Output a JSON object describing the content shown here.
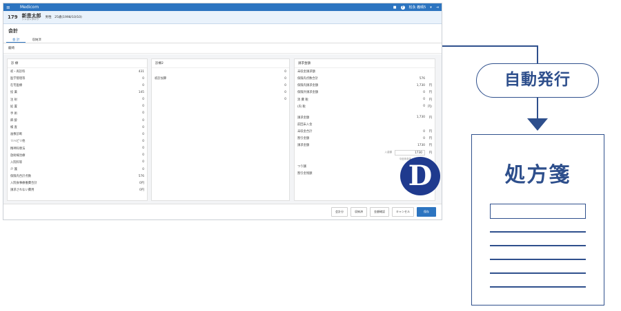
{
  "header": {
    "app_title": "Medicom",
    "user_name": "松永 義晴5",
    "help_icon_label": "?"
  },
  "patient": {
    "id": "179",
    "name": "新患太郎",
    "kana": "シンカンタロウ",
    "info": "男性　25歳(1998/10/10)"
  },
  "page": {
    "title": "会計",
    "subtitle": "龍崎"
  },
  "tabs": [
    {
      "label": "会 計",
      "active": true
    },
    {
      "label": "収納済",
      "active": false
    }
  ],
  "panels": {
    "shinryo": {
      "title": "診 療",
      "rows": [
        {
          "label": "初・再診料",
          "value": "431"
        },
        {
          "label": "医学管理等",
          "value": "0"
        },
        {
          "label": "在宅医療",
          "value": "0"
        },
        {
          "label": "投 薬",
          "value": "145"
        },
        {
          "label": "注 射",
          "value": "0"
        },
        {
          "label": "処 置",
          "value": "0"
        },
        {
          "label": "手 術",
          "value": "0"
        },
        {
          "label": "麻 酔",
          "value": "0"
        },
        {
          "label": "検 査",
          "value": "0"
        },
        {
          "label": "画像診断",
          "value": "0"
        },
        {
          "label": "リハビリ他",
          "value": "0"
        },
        {
          "label": "精神科専法",
          "value": "0"
        },
        {
          "label": "放射線治療",
          "value": "0"
        },
        {
          "label": "入院料等",
          "value": "0"
        },
        {
          "label": "介 護",
          "value": "0"
        },
        {
          "label": "保険内合計点数",
          "value": "576"
        },
        {
          "label": "入院食事療養費合計",
          "value": "0円"
        },
        {
          "label": "請求されない費用",
          "value": "0円"
        }
      ]
    },
    "shinryo2": {
      "title": "診療2",
      "rows": [
        {
          "label": "",
          "value": "0"
        },
        {
          "label": "初診加算",
          "value": "0"
        },
        {
          "label": "",
          "value": "0"
        },
        {
          "label": "",
          "value": "0"
        },
        {
          "label": "",
          "value": "0"
        }
      ]
    },
    "seikyu": {
      "title": "請求金額",
      "rows": [
        {
          "label": "未収金請求額",
          "value": "",
          "unit": ""
        },
        {
          "label": "保険内点数合計",
          "value": "576",
          "unit": ""
        },
        {
          "label": "保険内請求金額",
          "value": "1,730",
          "unit": "円"
        },
        {
          "label": "保険外請求金額",
          "value": "0",
          "unit": "円"
        },
        {
          "label": "消 費 税",
          "value": "0",
          "unit": "円"
        },
        {
          "label": "(内 税",
          "value": "0",
          "unit": "円)"
        },
        {
          "label": "",
          "value": "",
          "unit": ""
        },
        {
          "label": "請求金額",
          "value": "1,730",
          "unit": "円"
        },
        {
          "label": "前回未入金",
          "value": "",
          "unit": ""
        },
        {
          "label": "未収金合計",
          "value": "0",
          "unit": "円"
        },
        {
          "label": "割引金額",
          "value": "0",
          "unit": "円"
        },
        {
          "label": "請求金額",
          "value": "1730",
          "unit": "円"
        }
      ],
      "received_label": "入金額",
      "received_value": "1730",
      "received_unit": "円",
      "prev_label": "今回未収金",
      "change_label": "つり銭",
      "discount_remaining_label": "割引金残額"
    }
  },
  "footer": {
    "buttons": [
      {
        "label": "会計分",
        "primary": false
      },
      {
        "label": "収納済",
        "primary": false
      },
      {
        "label": "金額確認",
        "primary": false
      },
      {
        "label": "キャンセル",
        "primary": false
      },
      {
        "label": "保存",
        "primary": true
      }
    ]
  },
  "badge": {
    "letter": "D",
    "color": "#1f3a8e"
  },
  "annotation": {
    "pill_text": "自動発行",
    "doc_title": "処方箋",
    "color": "#2e4f8c"
  }
}
